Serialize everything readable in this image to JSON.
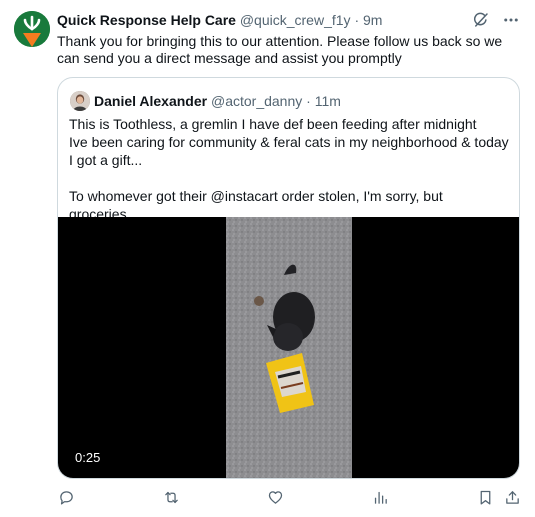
{
  "tweet": {
    "display_name": "Quick Response Help Care",
    "handle": "@quick_crew_f1y",
    "separator": "·",
    "time": "9m",
    "text": "Thank you for bringing this to our attention. Please follow us back so we can send you a direct message and assist you promptly",
    "brand_color": "#197a3c",
    "accent_color": "#f57c1f"
  },
  "quoted": {
    "display_name": "Daniel Alexander",
    "handle": "@actor_danny",
    "separator": "·",
    "time": "11m",
    "line1": "This is Toothless, a gremlin I have def been feeding after midnight",
    "line2": "Ive been caring for community & feral cats in my neighborhood & today I got a gift...",
    "line3": "To whomever got their @instacart order stolen, I'm sorry, but groceries...",
    "video_duration": "0:25"
  },
  "icons": {
    "top": [
      "grok-icon",
      "more-icon"
    ],
    "actions": [
      "reply-icon",
      "retweet-icon",
      "like-icon",
      "views-icon",
      "bookmark-icon",
      "share-icon"
    ]
  },
  "colors": {
    "text_primary": "#0f1419",
    "text_secondary": "#536471",
    "border": "#cfd9de"
  }
}
